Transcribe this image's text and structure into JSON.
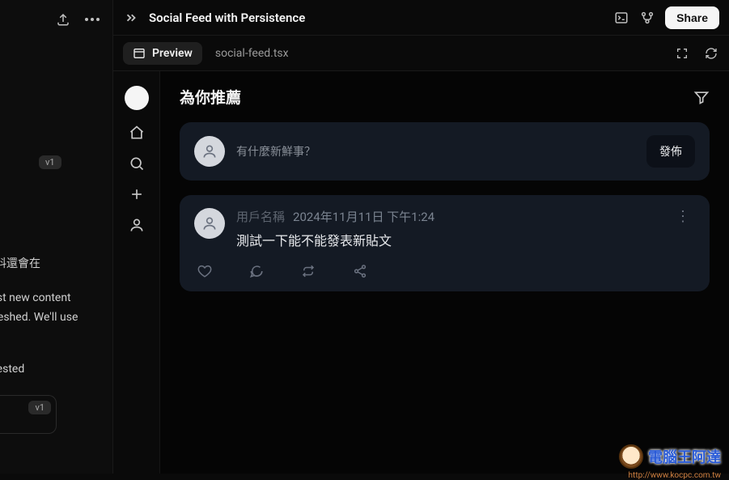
{
  "left_panel": {
    "version_badge_1": "v1",
    "version_badge_2": "v1",
    "text_1": "資料還會在",
    "text_2": "post new content",
    "text_3": "efreshed. We'll use",
    "text_4": "quested"
  },
  "topbar": {
    "title": "Social Feed with Persistence",
    "share_label": "Share"
  },
  "tabbar": {
    "preview_label": "Preview",
    "file_label": "social-feed.tsx"
  },
  "app": {
    "header_title": "為你推薦",
    "compose": {
      "placeholder": "有什麼新鮮事？",
      "publish_label": "發佈"
    },
    "post": {
      "username": "用戶名稱",
      "timestamp": "2024年11月11日 下午1:24",
      "content": "測試一下能不能發表新貼文"
    }
  },
  "watermark": {
    "main": "電腦王阿達",
    "sub": "http://www.kocpc.com.tw"
  }
}
